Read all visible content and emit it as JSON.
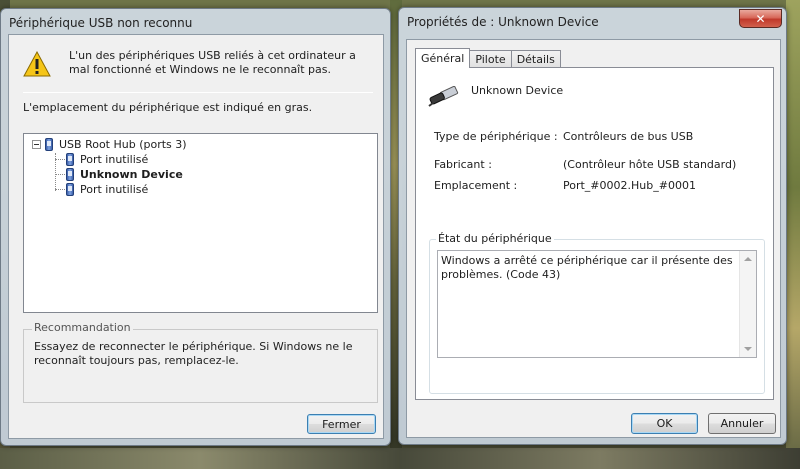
{
  "left_window": {
    "title": "Périphérique USB non reconnu",
    "warning_text": "L'un des périphériques USB reliés à cet ordinateur a mal fonctionné et Windows ne le reconnaît pas.",
    "location_text": "L'emplacement du périphérique est indiqué en gras.",
    "tree": {
      "root_label": "USB Root Hub (ports 3)",
      "children": [
        {
          "label": "Port inutilisé",
          "bold": false
        },
        {
          "label": "Unknown Device",
          "bold": true
        },
        {
          "label": "Port inutilisé",
          "bold": false
        }
      ]
    },
    "recommendation": {
      "title": "Recommandation",
      "text": "Essayez de reconnecter le périphérique. Si Windows ne le reconnaît toujours pas, remplacez-le."
    },
    "close_button_label": "Fermer"
  },
  "right_window": {
    "title": "Propriétés de : Unknown Device",
    "close_glyph": "✕",
    "tabs": [
      {
        "label": "Général",
        "active": true
      },
      {
        "label": "Pilote",
        "active": false
      },
      {
        "label": "Détails",
        "active": false
      }
    ],
    "device_name": "Unknown Device",
    "properties": [
      {
        "label": "Type de périphérique :",
        "value": "Contrôleurs de bus USB"
      },
      {
        "label": "Fabricant :",
        "value": "(Contrôleur hôte USB standard)"
      },
      {
        "label": "Emplacement :",
        "value": "Port_#0002.Hub_#0001"
      }
    ],
    "state": {
      "title": "État du périphérique",
      "text": "Windows a arrêté ce périphérique car il présente des problèmes. (Code 43)"
    },
    "ok_label": "OK",
    "cancel_label": "Annuler"
  },
  "icons": {
    "warning": "warning-icon",
    "usb_hub": "usb-hub-icon",
    "usb_device": "usb-device-icon",
    "usb_plug": "usb-plug-icon"
  },
  "colors": {
    "warning_yellow": "#f5c518",
    "close_red": "#c0392b",
    "default_button_border": "#3c7fb1"
  }
}
